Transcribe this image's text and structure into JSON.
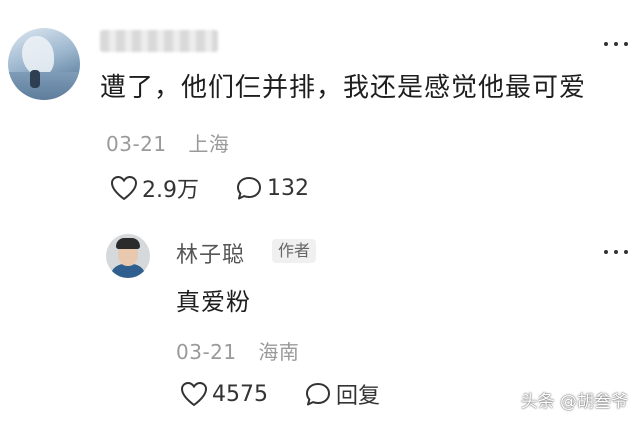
{
  "comment": {
    "text": "遭了，他们仨并排，我还是感觉他最可爱",
    "date": "03-21",
    "location": "上海",
    "likes": "2.9万",
    "replies": "132",
    "icons": {
      "avatar": "user-avatar",
      "more": "more-dots-icon",
      "like": "heart-icon",
      "reply": "comment-bubble-icon"
    }
  },
  "reply": {
    "username": "林子聪",
    "badge": "作者",
    "text": "真爱粉",
    "date": "03-21",
    "location": "海南",
    "likes": "4575",
    "reply_label": "回复"
  },
  "watermark": "头条 @胡叁爷",
  "colors": {
    "text_primary": "#1e1e1e",
    "text_meta": "#9a9a9a",
    "name": "#555555",
    "badge_bg": "#f0f0f0"
  }
}
